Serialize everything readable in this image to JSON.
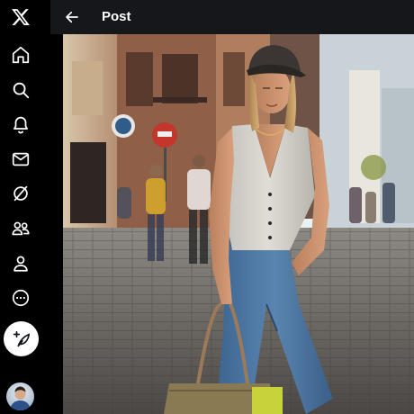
{
  "app": {
    "logo_icon": "x-logo-icon",
    "theme": {
      "background": "#000000",
      "text": "#ffffff",
      "header_bg": "#16181c"
    }
  },
  "nav": {
    "items": [
      {
        "name": "home",
        "icon": "home-icon"
      },
      {
        "name": "explore",
        "icon": "search-icon"
      },
      {
        "name": "notifications",
        "icon": "bell-icon"
      },
      {
        "name": "messages",
        "icon": "envelope-icon"
      },
      {
        "name": "grok",
        "icon": "grok-icon"
      },
      {
        "name": "communities",
        "icon": "people-icon"
      },
      {
        "name": "profile",
        "icon": "person-icon"
      },
      {
        "name": "more",
        "icon": "more-circle-icon"
      }
    ],
    "compose_icon": "feather-plus-icon",
    "account_avatar": "avatar"
  },
  "header": {
    "back_icon": "arrow-left-icon",
    "title": "Post"
  },
  "media": {
    "type": "photo"
  }
}
